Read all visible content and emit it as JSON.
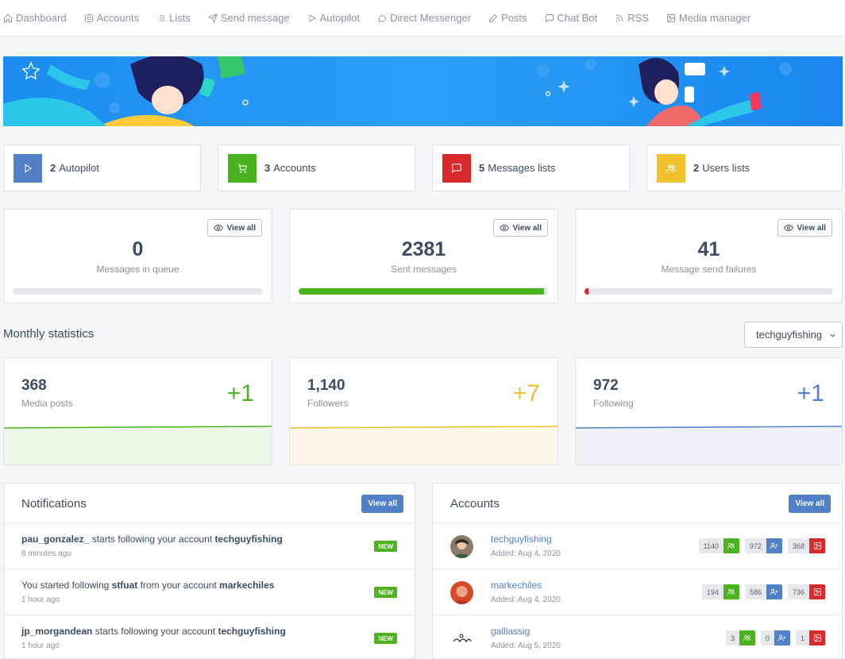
{
  "nav": [
    {
      "label": "Dashboard",
      "icon": "home-icon"
    },
    {
      "label": "Accounts",
      "icon": "instagram-icon"
    },
    {
      "label": "Lists",
      "icon": "list-icon"
    },
    {
      "label": "Send message",
      "icon": "send-icon"
    },
    {
      "label": "Autopilot",
      "icon": "play-icon"
    },
    {
      "label": "Direct Messenger",
      "icon": "chat-bubble-icon"
    },
    {
      "label": "Posts",
      "icon": "pencil-icon"
    },
    {
      "label": "Chat Bot",
      "icon": "message-square-icon"
    },
    {
      "label": "RSS",
      "icon": "rss-icon"
    },
    {
      "label": "Media manager",
      "icon": "image-icon"
    }
  ],
  "stats": [
    {
      "count": "2",
      "label": "Autopilot",
      "color": "#4f80c8",
      "icon": "play-icon"
    },
    {
      "count": "3",
      "label": "Accounts",
      "color": "#4bb31e",
      "icon": "cart-icon"
    },
    {
      "count": "5",
      "label": "Messages lists",
      "color": "#d82a2a",
      "icon": "message-square-icon"
    },
    {
      "count": "2",
      "label": "Users lists",
      "color": "#f1c12e",
      "icon": "users-icon"
    }
  ],
  "queue": [
    {
      "value": "0",
      "label": "Messages in queue",
      "button": "View all",
      "progress": 0,
      "color": "#4bb31e"
    },
    {
      "value": "2381",
      "label": "Sent messages",
      "button": "View all",
      "progress": 0.98,
      "color": "#4bb31e"
    },
    {
      "value": "41",
      "label": "Message send failures",
      "button": "View all",
      "progress": 0.017,
      "color": "#d82a2a"
    }
  ],
  "monthly": {
    "title": "Monthly statistics",
    "selected_account": "techguyfishing",
    "cards": [
      {
        "value": "368",
        "label": "Media posts",
        "delta": "+1",
        "color": "#4bb31e",
        "bg": "#eef8e9"
      },
      {
        "value": "1,140",
        "label": "Followers",
        "delta": "+7",
        "color": "#f1c12e",
        "bg": "#fef8ea"
      },
      {
        "value": "972",
        "label": "Following",
        "delta": "+1",
        "color": "#4f80c8",
        "bg": "#edf2f9"
      }
    ]
  },
  "notifications": {
    "title": "Notifications",
    "button": "View all",
    "badge": "NEW",
    "items": [
      {
        "parts": [
          {
            "t": "pau_gonzalez_",
            "b": true
          },
          {
            "t": " starts following your account ",
            "b": false
          },
          {
            "t": "techguyfishing",
            "b": true
          }
        ],
        "time": "8 minutes ago"
      },
      {
        "parts": [
          {
            "t": "You started following ",
            "b": false
          },
          {
            "t": "stfuat",
            "b": true
          },
          {
            "t": " from your account ",
            "b": false
          },
          {
            "t": "markechiles",
            "b": true
          }
        ],
        "time": "1 hour ago"
      },
      {
        "parts": [
          {
            "t": "jp_morgandean",
            "b": true
          },
          {
            "t": " starts following your account ",
            "b": false
          },
          {
            "t": "techguyfishing",
            "b": true
          }
        ],
        "time": "1 hour ago"
      }
    ]
  },
  "accounts": {
    "title": "Accounts",
    "button": "View all",
    "items": [
      {
        "name": "techguyfishing",
        "added": "Added: Aug 4, 2020",
        "followers": "1140",
        "following": "972",
        "posts": "368"
      },
      {
        "name": "markechiles",
        "added": "Added: Aug 4, 2020",
        "followers": "194",
        "following": "586",
        "posts": "736"
      },
      {
        "name": "galliassig",
        "added": "Added: Aug 5, 2020",
        "followers": "3",
        "following": "0",
        "posts": "1"
      }
    ]
  }
}
